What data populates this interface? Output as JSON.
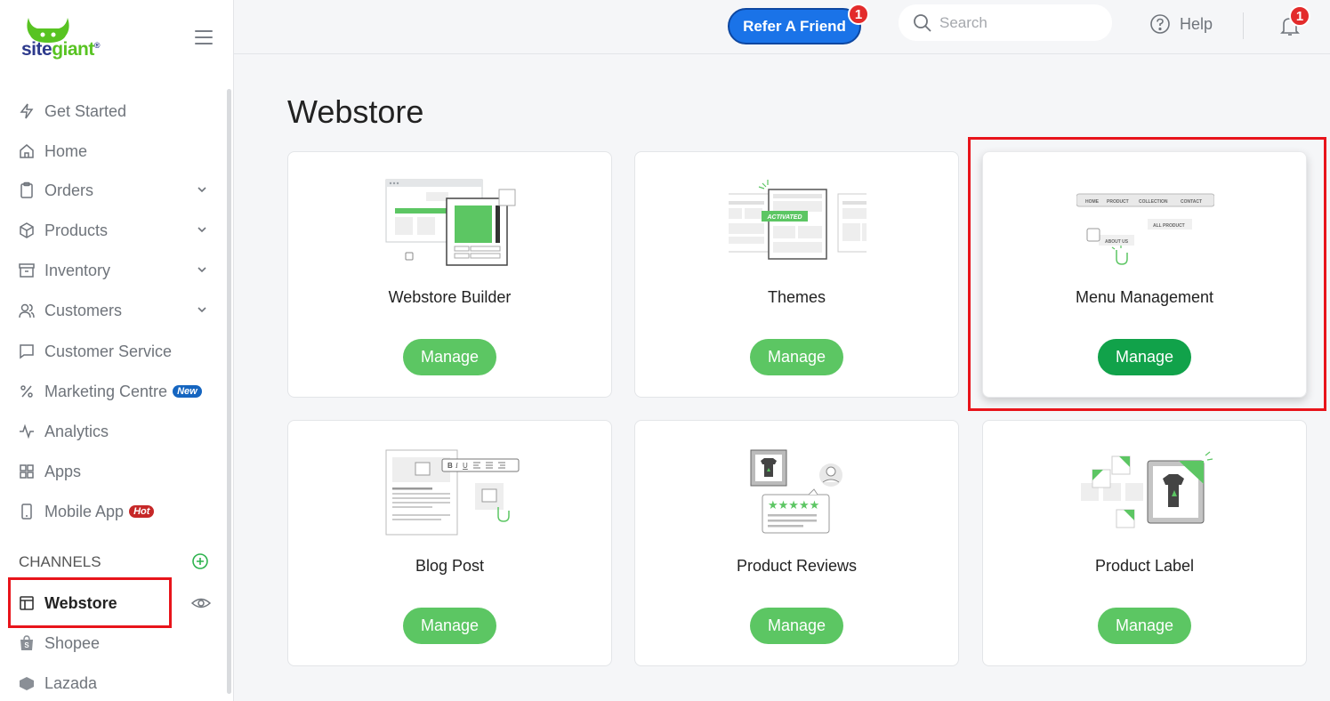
{
  "brand": {
    "logo_part1": "site",
    "logo_part2": "giant",
    "logo_mark": "®"
  },
  "sidebar": {
    "items": [
      {
        "label": "Get Started",
        "icon": "bolt-icon"
      },
      {
        "label": "Home",
        "icon": "home-icon"
      },
      {
        "label": "Orders",
        "icon": "clipboard-icon",
        "expandable": true
      },
      {
        "label": "Products",
        "icon": "box-icon",
        "expandable": true
      },
      {
        "label": "Inventory",
        "icon": "archive-icon",
        "expandable": true
      },
      {
        "label": "Customers",
        "icon": "users-icon",
        "expandable": true
      },
      {
        "label": "Customer Service",
        "icon": "chat-icon"
      },
      {
        "label": "Marketing Centre",
        "icon": "percent-icon",
        "badge": "New"
      },
      {
        "label": "Analytics",
        "icon": "pulse-icon"
      },
      {
        "label": "Apps",
        "icon": "grid-icon"
      },
      {
        "label": "Mobile App",
        "icon": "phone-icon",
        "badge": "Hot"
      }
    ],
    "channels_heading": "CHANNELS",
    "channels": [
      {
        "label": "Webstore",
        "icon": "layout-icon",
        "active": true
      },
      {
        "label": "Shopee",
        "icon": "shopee-icon"
      },
      {
        "label": "Lazada",
        "icon": "lazada-icon"
      }
    ]
  },
  "topbar": {
    "refer_label": "Refer A Friend",
    "refer_count": "1",
    "search_placeholder": "Search",
    "help_label": "Help",
    "notifications_count": "1"
  },
  "page": {
    "title": "Webstore",
    "cards": [
      {
        "title": "Webstore Builder",
        "button": "Manage"
      },
      {
        "title": "Themes",
        "button": "Manage",
        "illus_tag": "ACTIVATED"
      },
      {
        "title": "Menu Management",
        "button": "Manage",
        "highlighted": true,
        "illus_menu": [
          "HOME",
          "PRODUCT",
          "COLLECTION",
          "CONTACT"
        ],
        "illus_sub1": "ALL PRODUCT",
        "illus_sub2": "ABOUT US"
      },
      {
        "title": "Blog Post",
        "button": "Manage"
      },
      {
        "title": "Product Reviews",
        "button": "Manage"
      },
      {
        "title": "Product Label",
        "button": "Manage"
      }
    ]
  },
  "colors": {
    "brand_green": "#5cc663",
    "brand_green_dark": "#11a24a",
    "accent_blue": "#1a73e8",
    "highlight_red": "#e8141b",
    "badge_red": "#e32b2b"
  }
}
